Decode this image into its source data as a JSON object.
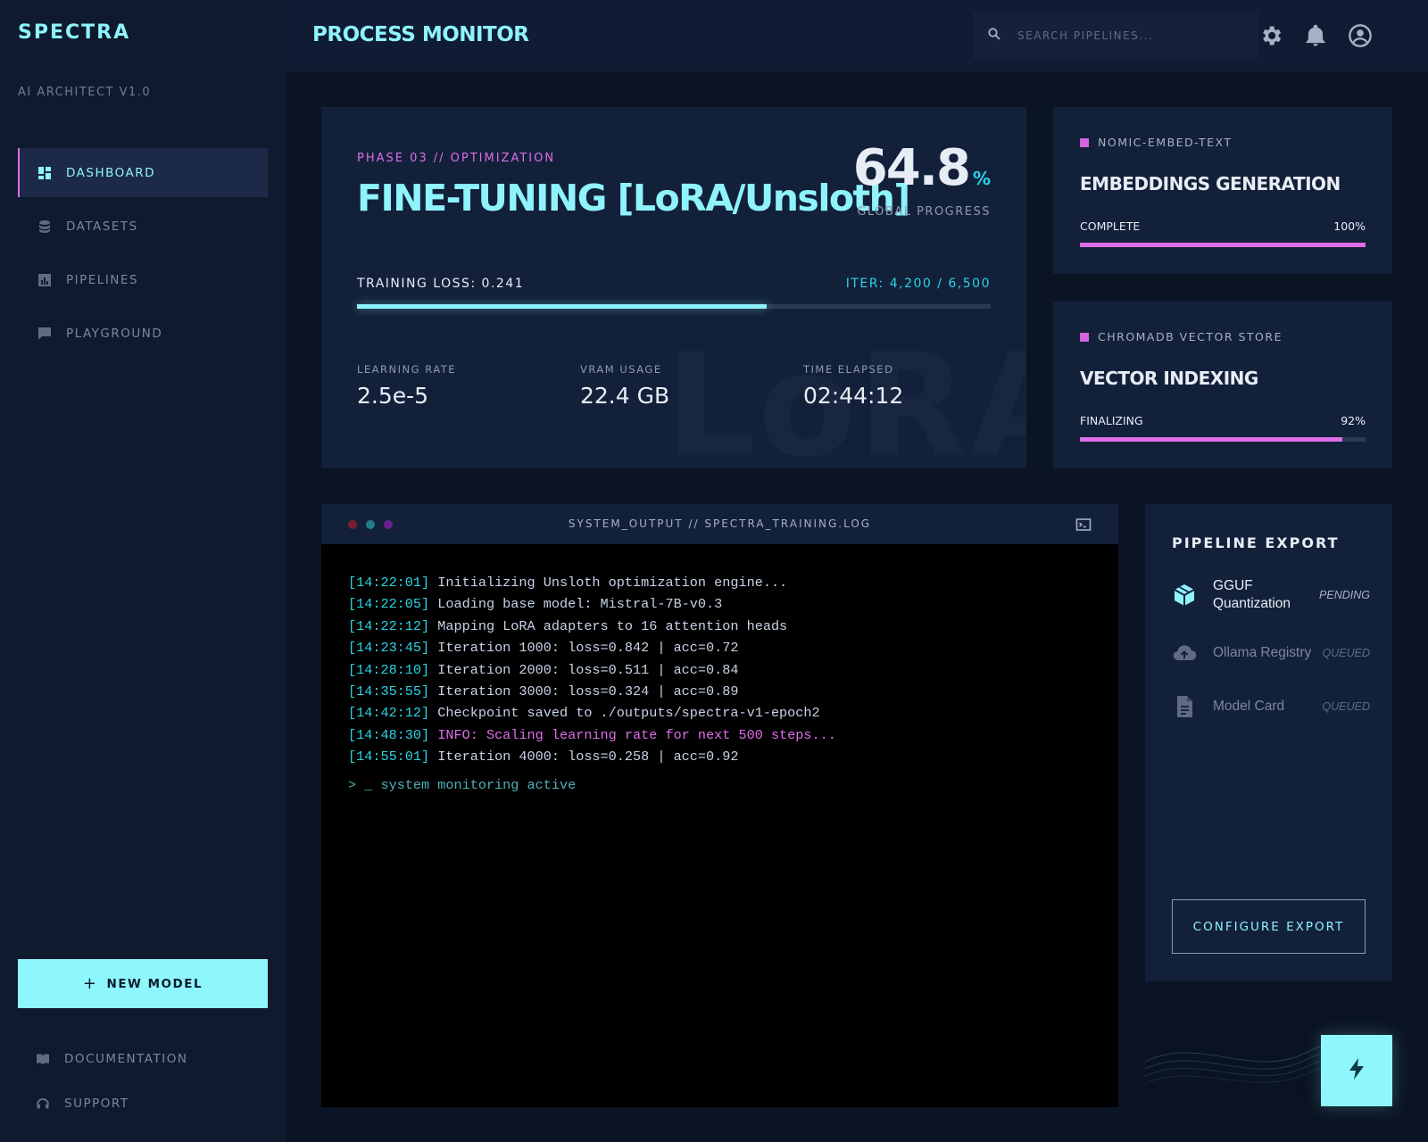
{
  "sidebar": {
    "brand": "SPECTRA",
    "version": "AI ARCHITECT V1.0",
    "items": [
      {
        "label": "DASHBOARD",
        "icon": "dashboard-icon",
        "active": true
      },
      {
        "label": "DATASETS",
        "icon": "database-icon",
        "active": false
      },
      {
        "label": "PIPELINES",
        "icon": "bar-chart-icon",
        "active": false
      },
      {
        "label": "PLAYGROUND",
        "icon": "chat-icon",
        "active": false
      }
    ],
    "new_model_label": "NEW MODEL",
    "footer": [
      {
        "label": "DOCUMENTATION",
        "icon": "book-icon"
      },
      {
        "label": "SUPPORT",
        "icon": "headset-icon"
      }
    ]
  },
  "header": {
    "title": "PROCESS MONITOR",
    "search_placeholder": "SEARCH PIPELINES...",
    "icons": [
      "settings-icon",
      "bell-icon",
      "account-icon"
    ]
  },
  "training": {
    "phase": "PHASE 03 // OPTIMIZATION",
    "title": "FINE-TUNING [LoRA/Unsloth]",
    "watermark": "LoRA",
    "global_progress_value": "64.8",
    "global_progress_unit": "%",
    "global_progress_label": "GLOBAL PROGRESS",
    "loss_label": "TRAINING LOSS: 0.241",
    "iter_label": "ITER: 4,200 / 6,500",
    "progress_fraction": 0.646,
    "metrics": [
      {
        "label": "LEARNING RATE",
        "value": "2.5e-5"
      },
      {
        "label": "VRAM USAGE",
        "value": "22.4 GB"
      },
      {
        "label": "TIME ELAPSED",
        "value": "02:44:12"
      }
    ]
  },
  "status_cards": [
    {
      "tag": "NOMIC-EMBED-TEXT",
      "title": "EMBEDDINGS GENERATION",
      "state": "COMPLETE",
      "percent_label": "100%",
      "fraction": 1.0
    },
    {
      "tag": "CHROMADB VECTOR STORE",
      "title": "VECTOR INDEXING",
      "state": "FINALIZING",
      "percent_label": "92%",
      "fraction": 0.92
    }
  ],
  "terminal": {
    "title": "SYSTEM_OUTPUT // SPECTRA_TRAINING.LOG",
    "dot_colors": [
      "#7a1f2e",
      "#1f7f8f",
      "#6a1f8f"
    ],
    "lines": [
      {
        "ts": "[14:22:01]",
        "msg": "Initializing Unsloth optimization engine...",
        "type": "normal"
      },
      {
        "ts": "[14:22:05]",
        "msg": "Loading base model: Mistral-7B-v0.3",
        "type": "normal"
      },
      {
        "ts": "[14:22:12]",
        "msg": "Mapping LoRA adapters to 16 attention heads",
        "type": "normal"
      },
      {
        "ts": "[14:23:45]",
        "msg": "Iteration 1000: loss=0.842 | acc=0.72",
        "type": "normal"
      },
      {
        "ts": "[14:28:10]",
        "msg": "Iteration 2000: loss=0.511 | acc=0.84",
        "type": "normal"
      },
      {
        "ts": "[14:35:55]",
        "msg": "Iteration 3000: loss=0.324 | acc=0.89",
        "type": "normal"
      },
      {
        "ts": "[14:42:12]",
        "msg": "Checkpoint saved to ./outputs/spectra-v1-epoch2",
        "type": "normal"
      },
      {
        "ts": "[14:48:30]",
        "msg": "INFO: Scaling learning rate for next 500 steps...",
        "type": "info"
      },
      {
        "ts": "[14:55:01]",
        "msg": "Iteration 4000: loss=0.258 | acc=0.92",
        "type": "normal"
      }
    ],
    "prompt": "> _ system monitoring active"
  },
  "export": {
    "title": "PIPELINE EXPORT",
    "items": [
      {
        "name": "GGUF Quantization",
        "status": "PENDING",
        "icon": "cube-icon",
        "state": "pending"
      },
      {
        "name": "Ollama Registry",
        "status": "QUEUED",
        "icon": "cloud-upload-icon",
        "state": "queued"
      },
      {
        "name": "Model Card",
        "status": "QUEUED",
        "icon": "document-icon",
        "state": "queued"
      }
    ],
    "configure_label": "CONFIGURE EXPORT"
  },
  "fab_icon": "bolt-icon",
  "colors": {
    "accent_cyan": "#8ef3fb",
    "accent_magenta": "#dd6ee8",
    "panel": "#13203a",
    "background": "#0b1424"
  }
}
